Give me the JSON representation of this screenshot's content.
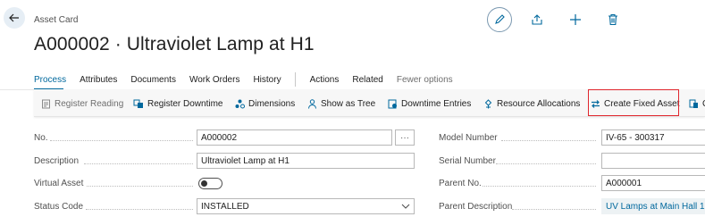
{
  "header": {
    "card_type": "Asset Card",
    "title": "A000002 · Ultraviolet Lamp at H1"
  },
  "tabs": [
    {
      "label": "Process",
      "active": true
    },
    {
      "label": "Attributes"
    },
    {
      "label": "Documents"
    },
    {
      "label": "Work Orders"
    },
    {
      "label": "History"
    },
    {
      "label": "Actions"
    },
    {
      "label": "Related"
    },
    {
      "label": "Fewer options"
    }
  ],
  "actions": {
    "register_reading": "Register Reading",
    "register_downtime": "Register Downtime",
    "dimensions": "Dimensions",
    "show_as_tree": "Show as Tree",
    "downtime_entries": "Downtime Entries",
    "resource_allocations": "Resource Allocations",
    "create_fixed_asset": "Create Fixed Asset",
    "truncated_next": "C"
  },
  "fields": {
    "no": {
      "label": "No.",
      "value": "A000002"
    },
    "description": {
      "label": "Description",
      "value": "Ultraviolet Lamp at H1"
    },
    "virtual_asset": {
      "label": "Virtual Asset",
      "value": "off"
    },
    "status_code": {
      "label": "Status Code",
      "value": "INSTALLED"
    },
    "model_number": {
      "label": "Model Number",
      "value": "IV-65 - 300317"
    },
    "serial_number": {
      "label": "Serial Number",
      "value": ""
    },
    "parent_no": {
      "label": "Parent No.",
      "value": "A000001"
    },
    "parent_description": {
      "label": "Parent Description",
      "value": "UV Lamps at Main Hall 1"
    }
  },
  "assist_button": "···",
  "colors": {
    "accent": "#00689d",
    "highlight": "#e0262d",
    "action_icon": "#00689d"
  }
}
